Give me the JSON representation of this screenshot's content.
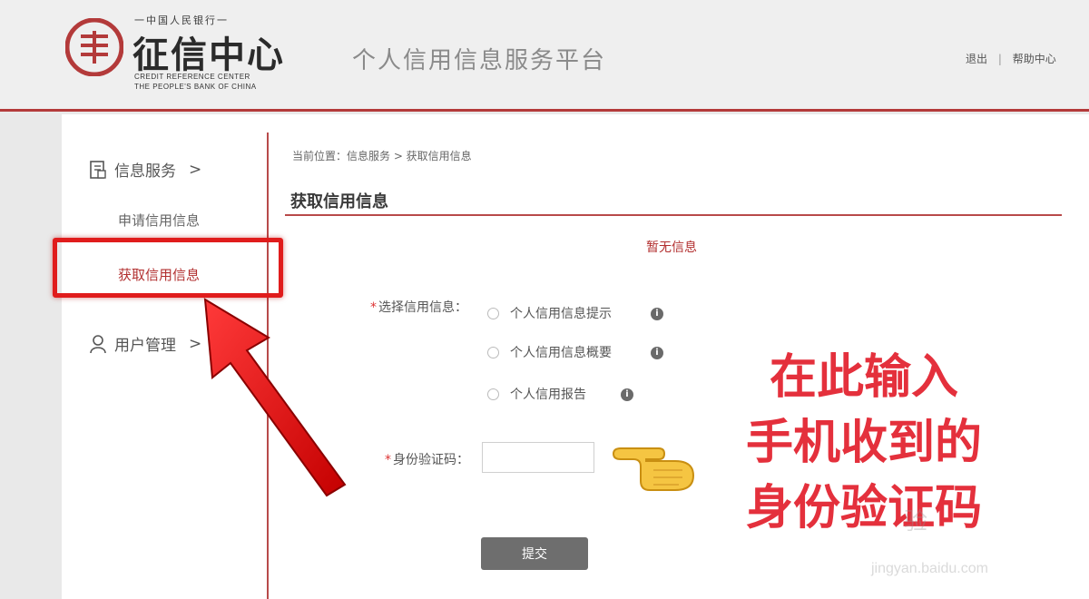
{
  "header": {
    "logo_top": "一中国人民银行一",
    "logo_main": "征信中心",
    "logo_en_line1": "CREDIT REFERENCE CENTER",
    "logo_en_line2": "THE PEOPLE'S BANK OF CHINA",
    "platform_title": "个人信用信息服务平台",
    "links": {
      "logout": "退出",
      "separator": "|",
      "help": "帮助中心"
    }
  },
  "sidebar": {
    "groups": [
      {
        "label": "信息服务",
        "chevron": ">",
        "icon": "document-icon"
      },
      {
        "label": "用户管理",
        "chevron": ">",
        "icon": "user-icon"
      }
    ],
    "items": [
      {
        "label": "申请信用信息"
      },
      {
        "label": "获取信用信息",
        "active": true
      }
    ]
  },
  "main": {
    "breadcrumb": "当前位置：信息服务 > 获取信用信息",
    "title": "获取信用信息",
    "notice": "暂无信息",
    "select_label": "选择信用信息：",
    "required_mark": "*",
    "options": [
      {
        "label": "个人信用信息提示"
      },
      {
        "label": "个人信用信息概要"
      },
      {
        "label": "个人信用报告"
      }
    ],
    "info_icon": "i",
    "code_label": "身份验证码：",
    "code_value": "",
    "submit_label": "提交"
  },
  "annotation": {
    "lines": [
      "在此输入",
      "手机收到的",
      "身份验证码"
    ]
  },
  "watermark": {
    "line1": "验",
    "line2": "jingyan.baidu.com"
  },
  "colors": {
    "brand_red": "#b33a3a",
    "annotation_red": "#e4303c",
    "highlight_red": "#e01c1c",
    "button_gray": "#6e6e6e"
  }
}
